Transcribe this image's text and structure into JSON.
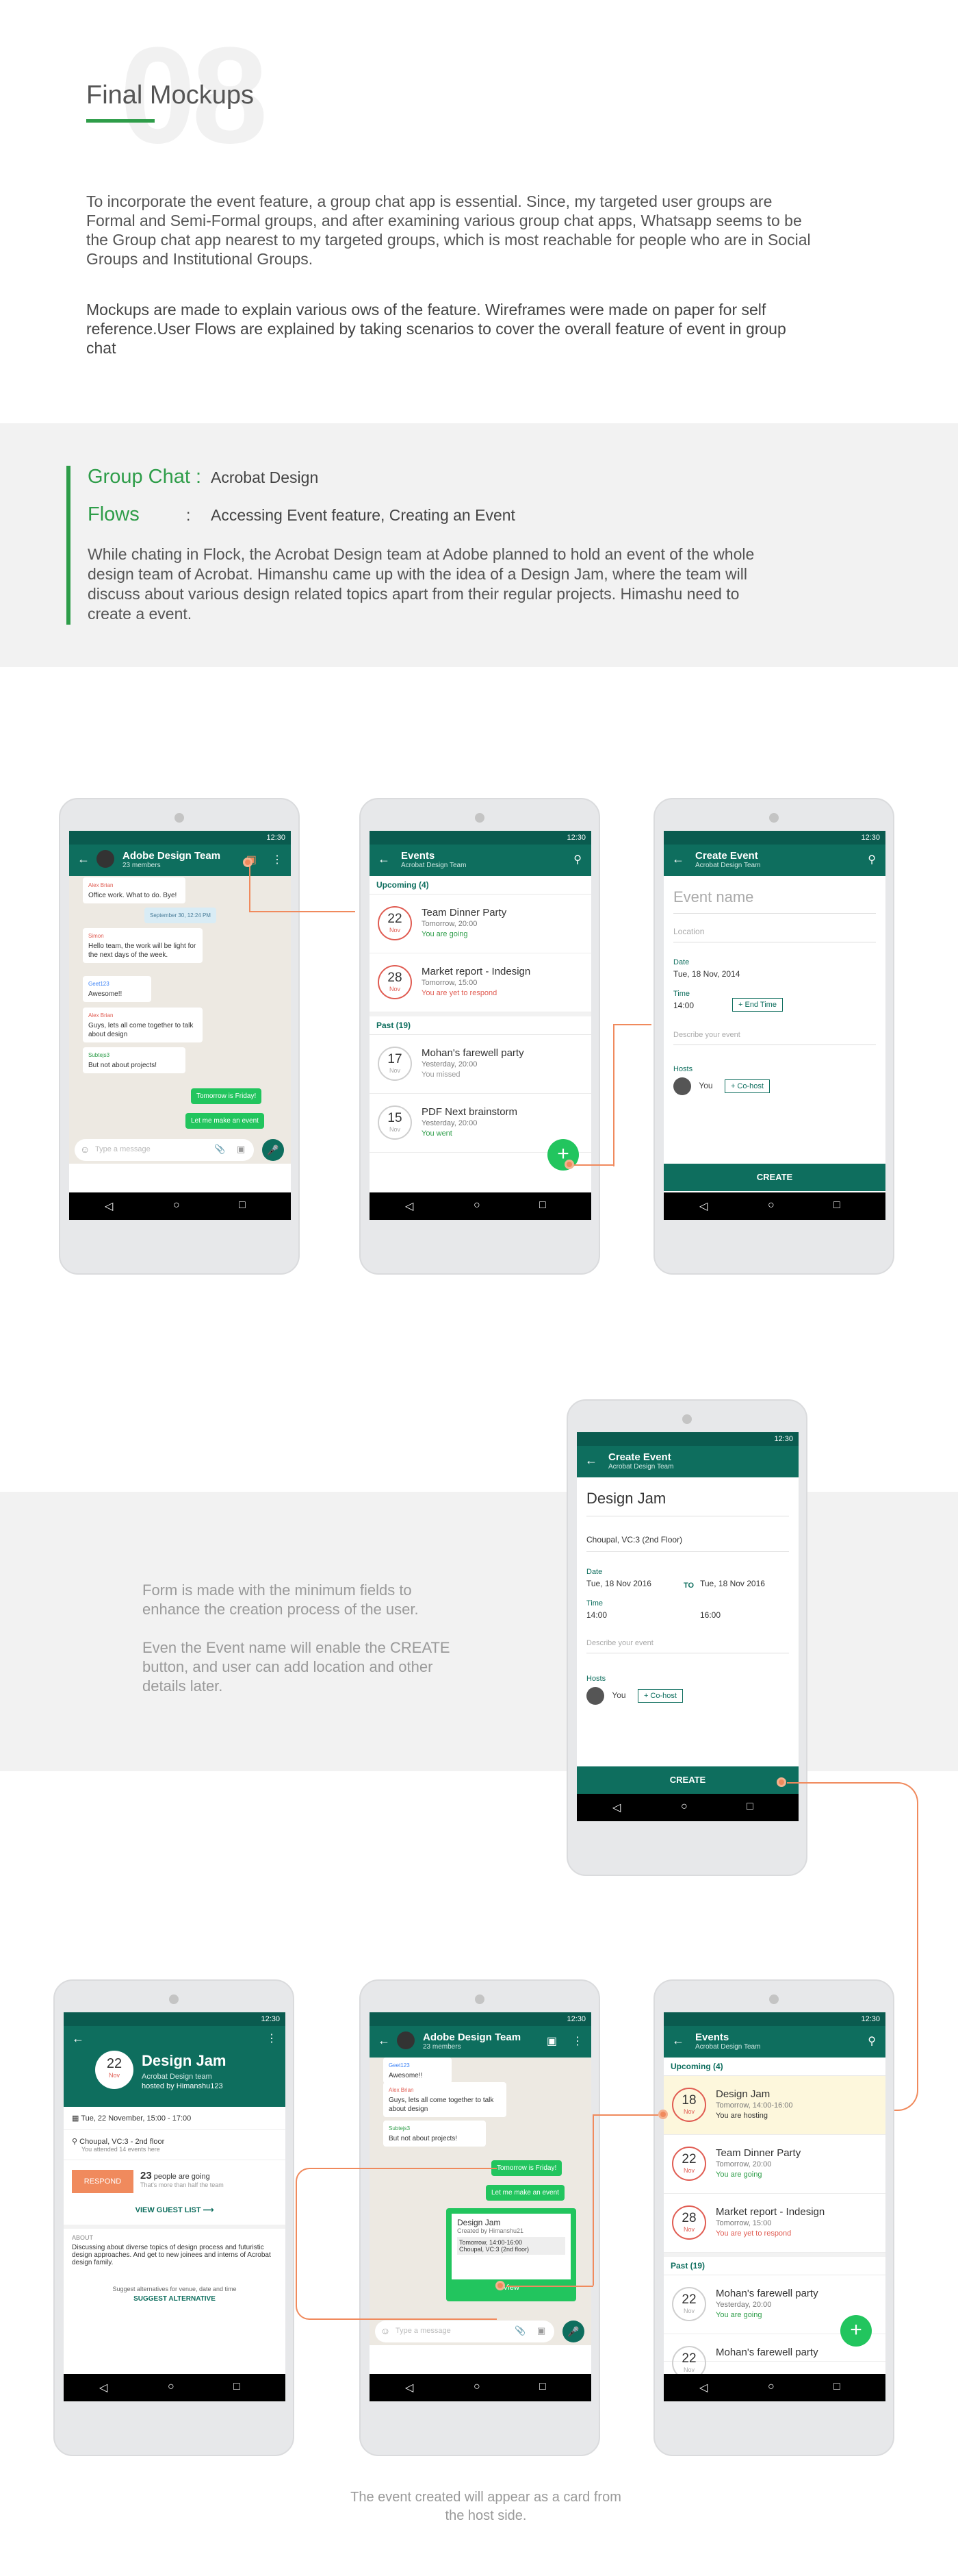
{
  "header": {
    "number": "08",
    "title": "Final Mockups"
  },
  "intro": {
    "p1": "To incorporate the event feature, a group chat app is essential. Since, my targeted user groups are Formal and Semi-Formal groups, and after examining various group chat apps, Whatsapp seems to be the Group chat app nearest to my targeted groups, which is most reachable for people who are in Social Groups and Institutional Groups.",
    "p2": "Mockups are made to explain various  ows of the feature. Wireframes were made on paper for self reference.User Flows are explained by taking scenarios to cover the overall feature of event in group chat"
  },
  "scenario": {
    "group_label": "Group Chat :",
    "group_val": "Acrobat Design",
    "flows_label": "Flows",
    "flows_colon": ":",
    "flows_val": "Accessing Event feature, Creating an Event",
    "desc": "While chating in Flock, the Acrobat Design team at Adobe planned to hold an event of the whole design team of Acrobat. Himanshu came up with the idea of a Design Jam, where the team will discuss about various design related topics apart from their regular projects. Himashu need to create a event."
  },
  "common": {
    "time": "12:30",
    "back": "←",
    "search": "⚲",
    "menu": "⋮",
    "nav_back": "◁",
    "nav_home": "○",
    "nav_recent": "□",
    "create": "CREATE",
    "hosts": "Hosts",
    "you": "You",
    "cohost": "+ Co-host",
    "mic": "🎤",
    "attach": "📎",
    "cam": "▣",
    "emoji": "☺",
    "plus": "+"
  },
  "chat": {
    "title": "Adobe Design Team",
    "sub": "23 members",
    "placeholder": "Type a message",
    "msgs": [
      {
        "who": "Alex Brian",
        "text": "Office work. What to do. Bye!"
      },
      {
        "date": "September 30, 12:24 PM"
      },
      {
        "who": "Simon",
        "text": "Hello team, the work will be light for the next days of the week."
      },
      {
        "who": "Geet123",
        "text": "Awesome!!"
      },
      {
        "who": "Alex Brian",
        "text": "Guys, lets all come together to talk about design"
      },
      {
        "who": "Subtejs3",
        "text": "But not about projects!"
      }
    ],
    "me1": "Tomorrow is Friday!",
    "me2": "Let me make an event"
  },
  "events": {
    "title": "Events",
    "sub": "Acrobat Design Team",
    "upcoming": "Upcoming (4)",
    "past": "Past (19)",
    "list": [
      {
        "d": "22",
        "m": "Nov",
        "name": "Team Dinner Party",
        "when": "Tomorrow, 20:00",
        "status": "You are going"
      },
      {
        "d": "28",
        "m": "Nov",
        "name": "Market report - Indesign",
        "when": "Tomorrow, 15:00",
        "status": "You are yet to respond"
      },
      {
        "d": "17",
        "m": "Nov",
        "name": "Mohan's farewell party",
        "when": "Yesterday, 20:00",
        "status": "You missed"
      },
      {
        "d": "15",
        "m": "Nov",
        "name": "PDF Next brainstorm",
        "when": "Yesterday, 20:00",
        "status": "You went"
      }
    ]
  },
  "create": {
    "title": "Create Event",
    "sub": "Acrobat Design Team",
    "name_ph": "Event name",
    "loc_ph": "Location",
    "date_l": "Date",
    "date_v": "Tue, 18 Nov, 2014",
    "time_l": "Time",
    "time_v": "14:00",
    "end": "+ End Time",
    "desc_ph": "Describe your event"
  },
  "create2": {
    "name": "Design Jam",
    "loc": "Choupal, VC:3 (2nd Floor)",
    "date_l": "Date",
    "date1": "Tue, 18 Nov 2016",
    "to": "TO",
    "date2": "Tue, 18 Nov 2016",
    "time_l": "Time",
    "time1": "14:00",
    "time2": "16:00"
  },
  "band": {
    "p1": "Form is made with the minimum  fields to enhance the creation process of the user.",
    "p2": "Even the Event name will enable the CREATE button, and user can add location and other details later."
  },
  "detail": {
    "d": "22",
    "m": "Nov",
    "title": "Design Jam",
    "team": "Acrobat Design team",
    "host": "hosted by Himanshu123",
    "when": "Tue, 22 November, 15:00 - 17:00",
    "where": "Choupal, VC:3 - 2nd floor",
    "attended": "You attended 14 events here",
    "respond": "RESPOND",
    "going_n": "23",
    "going": "people are going",
    "going_sub": "That's more than half the team",
    "guest": "VIEW GUEST LIST  ⟶",
    "about_h": "ABOUT",
    "about": "Discussing about diverse topics of design process and futuristic design approaches. And get to new joinees and interns of Acrobat design family.",
    "suggest_h": "Suggest alternatives for venue, date and time",
    "suggest": "SUGGEST ALTERNATIVE"
  },
  "card": {
    "title": "Design Jam",
    "by": "Created by Himanshu21",
    "time": "Tomorrow, 14:00-16:00",
    "place": "Choupal, VC:3 (2nd floor)",
    "view": "View"
  },
  "events2": {
    "list": [
      {
        "d": "18",
        "m": "Nov",
        "name": "Design Jam",
        "when": "Tomorrow, 14:00-16:00",
        "status": "You are hosting"
      },
      {
        "d": "22",
        "m": "Nov",
        "name": "Team Dinner Party",
        "when": "Tomorrow, 20:00",
        "status": "You are going"
      },
      {
        "d": "28",
        "m": "Nov",
        "name": "Market report - Indesign",
        "when": "Tomorrow, 15:00",
        "status": "You are yet to respond"
      },
      {
        "d": "22",
        "m": "Nov",
        "name": "Mohan's farewell party",
        "when": "Yesterday, 20:00",
        "status": "You are going"
      },
      {
        "d": "22",
        "m": "Nov",
        "name": "Mohan's farewell party",
        "when": "",
        "status": ""
      }
    ]
  },
  "caption": "The event created will appear as a card from the host side."
}
